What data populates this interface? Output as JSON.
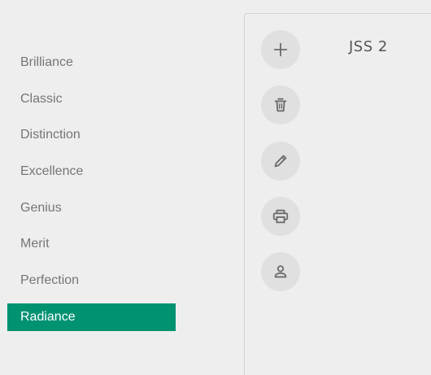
{
  "sidebar": {
    "items": [
      {
        "label": "Brilliance"
      },
      {
        "label": "Classic"
      },
      {
        "label": "Distinction"
      },
      {
        "label": "Excellence"
      },
      {
        "label": "Genius"
      },
      {
        "label": "Merit"
      },
      {
        "label": "Perfection"
      },
      {
        "label": "Radiance",
        "active": true
      }
    ],
    "active_color": "#009271"
  },
  "panel": {
    "title": "JSS 2",
    "actions": [
      {
        "icon": "plus-icon"
      },
      {
        "icon": "trash-icon"
      },
      {
        "icon": "pencil-icon"
      },
      {
        "icon": "printer-icon"
      },
      {
        "icon": "person-icon"
      }
    ]
  }
}
